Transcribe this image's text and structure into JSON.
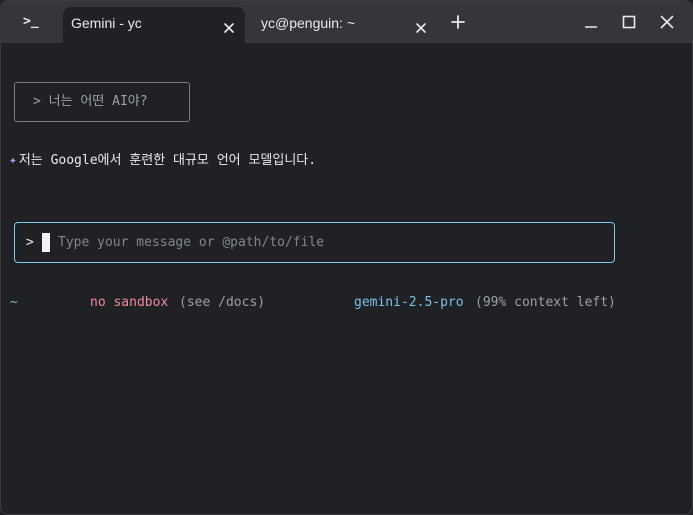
{
  "titlebar": {
    "app_icon_glyph": ">_",
    "tabs": [
      {
        "label": "Gemini - yc",
        "active": true
      },
      {
        "label": "yc@penguin: ~",
        "active": false
      }
    ]
  },
  "terminal": {
    "user_query": "> 너는 어떤 AI야?",
    "response_sparkle": "✦",
    "response_text": "저는 Google에서 훈련한 대규모 언어 모델입니다.",
    "input": {
      "prompt": ">",
      "value": "",
      "placeholder": "Type your message or @path/to/file"
    },
    "status": {
      "cwd": "~",
      "sandbox": "no sandbox",
      "sandbox_hint": "(see /docs)",
      "model": "gemini-2.5-pro",
      "context": "(99% context left)"
    }
  },
  "colors": {
    "background": "#202124",
    "titlebar": "#35363a",
    "input_border": "#7cc7ea",
    "accent_blue": "#78c2e6",
    "accent_pink": "#f28b9f",
    "sparkle": "#c58af9"
  }
}
